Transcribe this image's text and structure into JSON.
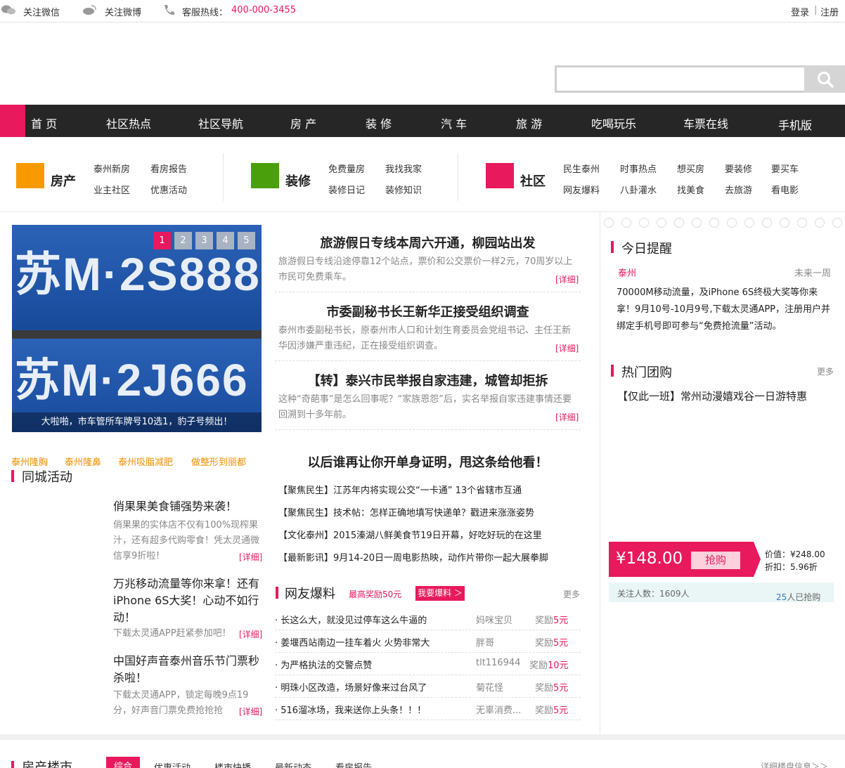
{
  "topbar": {
    "wechat_icon": "wechat-icon",
    "wechat": "关注微信",
    "weibo_icon": "weibo-icon",
    "weibo": "关注微博",
    "phone_icon": "phone-icon",
    "hotline_label": "客服热线：",
    "hotline_number": "400-000-3455",
    "login": "登录",
    "sep": "|",
    "register": "注册"
  },
  "search": {
    "value": "",
    "icon": "search-icon"
  },
  "nav": [
    "首 页",
    "社区热点",
    "社区导航",
    "房 产",
    "装 修",
    "汽 车",
    "旅 游",
    "吃喝玩乐",
    "车票在线",
    "手机版"
  ],
  "quick": {
    "house": {
      "title": "房产",
      "color": "#f79a00",
      "links": [
        "泰州新房",
        "看房报告",
        "业主社区",
        "优惠活动"
      ]
    },
    "decor": {
      "title": "装修",
      "color": "#4aa00c",
      "links": [
        "免费量房",
        "我找我家",
        "装修日记",
        "装修知识"
      ]
    },
    "community": {
      "title": "社区",
      "color": "#e8195c",
      "links": [
        "民生泰州",
        "时事热点",
        "想买房",
        "要装修",
        "要买车",
        "网友爆料",
        "八卦灌水",
        "找美食",
        "去旅游",
        "看电影"
      ]
    }
  },
  "slider": {
    "plate_top": "苏M·2S888",
    "plate_bottom": "苏M·2J666",
    "caption": "大啦啪，市车管所车牌号10选1，豹子号频出！",
    "dots": [
      "1",
      "2",
      "3",
      "4",
      "5"
    ],
    "active_dot": 1
  },
  "headlines": [
    {
      "title": "旅游假日专线本周六开通，柳园站出发",
      "body": "旅游假日专线沿途停靠12个站点，票价和公交票价一样2元，70周岁以上市民可免费乘车。",
      "detail": "[详细]"
    },
    {
      "title": "市委副秘书长王新华正接受组织调查",
      "body": "泰州市委副秘书长，原泰州市人口和计划生育委员会党组书记、主任王新华因涉嫌严重违纪，正在接受组织调查。",
      "detail": "[详细]"
    },
    {
      "title": "【转】泰兴市民举报自家违建，城管却拒拆",
      "body": "这种“奇葩事”是怎么回事呢？“家族恩怨”后，实名举报自家违建事情还要回溯到十多年前。",
      "detail": "[详细]"
    }
  ],
  "tags": [
    "泰州隆胸",
    "泰州隆鼻",
    "泰州吸脂减肥",
    "做整形到丽都"
  ],
  "activities": {
    "title": "同城活动",
    "items": [
      {
        "title": "俏果果美食铺强势来袭！",
        "body": "俏果果的实体店不仅有100%现榨果汁，还有超多代购零食！凭太灵通微信享9折啦！",
        "detail": "[详细]"
      },
      {
        "title": "万兆移动流量等你来拿！还有iPhone 6S大奖！心动不如行动！",
        "body": "下载太灵通APP赶紧参加吧！",
        "detail": "[详细]"
      },
      {
        "title": "中国好声音泰州音乐节门票秒杀啦！",
        "body": "下载太灵通APP，锁定每晚9点19分，好声音门票免费抢抢抢",
        "detail": "[详细]"
      }
    ]
  },
  "focus": {
    "title": "以后谁再让你开单身证明，甩这条给他看！",
    "items": [
      "【聚焦民生】江苏年内将实现公交“一卡通” 13个省辖市互通",
      "【聚焦民生】技术帖：怎样正确地填写快递单？戳进来涨涨姿势",
      "【文化泰州】2015溱湖八鲜美食节19日开幕，好吃好玩的在这里",
      "【最新影讯】9月14-20日一周电影热映，动作片带你一起大展拳脚"
    ]
  },
  "baoliao": {
    "title": "网友爆料",
    "badge": "最高奖励50元",
    "button": "我要爆料 ＞",
    "more": "更多",
    "reward_prefix": "奖励",
    "reward_suffix": "元",
    "rows": [
      {
        "text": "· 长这么大，就没见过停车这么牛逼的",
        "user": "妈咪宝贝",
        "reward": "5"
      },
      {
        "text": "· 姜堰西站南边一挂车着火 火势非常大",
        "user": "胖哥",
        "reward": "5"
      },
      {
        "text": "· 为严格执法的交警点赞",
        "user": "tlt116944",
        "reward": "10"
      },
      {
        "text": "· 明珠小区改造，场景好像来过台风了",
        "user": "菊花怪",
        "reward": "5"
      },
      {
        "text": "· 516溜冰场，我来送你上头条！！！",
        "user": "无辜消费...",
        "reward": "5"
      }
    ]
  },
  "reminder": {
    "title": "今日提醒",
    "city": "泰州",
    "range": "未来一周",
    "text": "70000M移动流量，及iPhone 6S终极大奖等你来拿！9月10号-10月9号,下载太灵通APP，注册用户并绑定手机号即可参与“免费抢流量”活动。"
  },
  "group": {
    "title": "热门团购",
    "more": "更多",
    "item": "【仅此一班】常州动漫嬉戏谷一日游特惠",
    "price": "¥148.00",
    "buy": "抢购",
    "value": "价值：¥248.00",
    "discount": "折扣：5.96折",
    "follow": "关注人数：1609人",
    "bought_count": "25",
    "bought_suffix": "人已抢购"
  },
  "bottom": {
    "title": "房产楼市",
    "tabs": [
      "综合",
      "优惠活动",
      "楼市快播",
      "最新动态",
      "看房报告"
    ],
    "more": "详细楼盘信息＞＞"
  },
  "colors": {
    "accent": "#e8195c",
    "nav_bg": "#262626",
    "tag": "#f08f00"
  }
}
